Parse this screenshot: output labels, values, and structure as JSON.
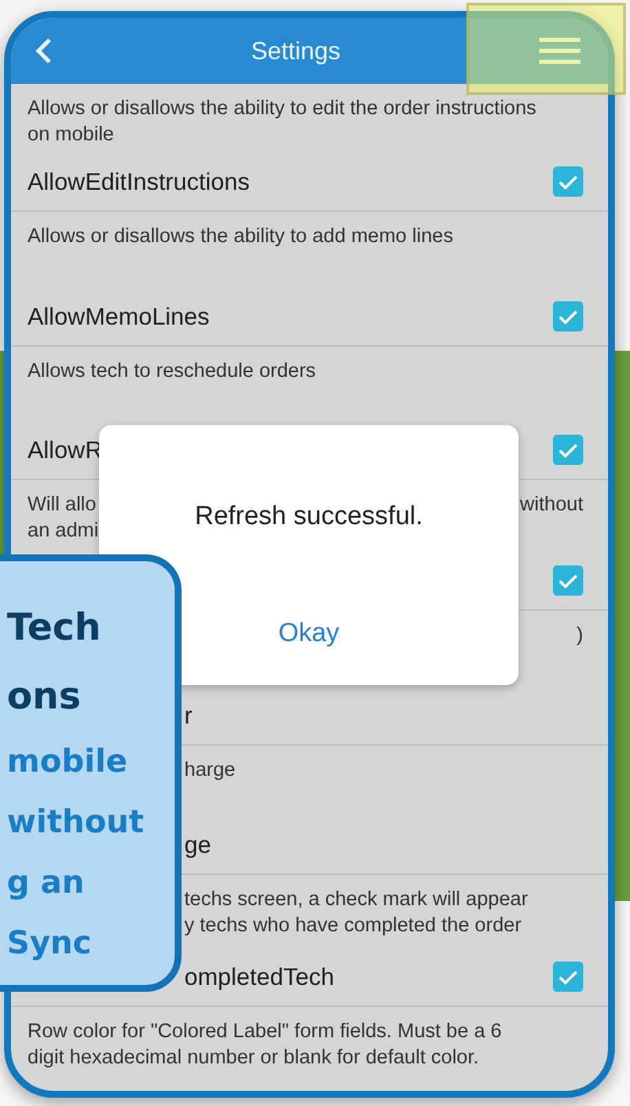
{
  "header": {
    "title": "Settings"
  },
  "rows": [
    {
      "description": [
        {
          "text": "Allows or disallows the ability to edit the order instructions",
          "kind": "start"
        },
        {
          "text": "on mobile",
          "kind": "start"
        }
      ],
      "name": [
        {
          "text": "AllowEditInstructions",
          "kind": "start"
        }
      ],
      "checked": true
    },
    {
      "description": [
        {
          "text": "Allows or disallows the ability to add memo lines",
          "kind": "start"
        }
      ],
      "name": [
        {
          "text": "AllowMemoLines",
          "kind": "start"
        }
      ],
      "checked": true
    },
    {
      "description": [
        {
          "text": "Allows tech to reschedule orders",
          "kind": "start"
        }
      ],
      "name": [
        {
          "text": "AllowR",
          "kind": "start"
        }
      ],
      "checked": true
    },
    {
      "description": [
        {
          "text": "Will allo",
          "kind": "start"
        },
        {
          "text": "without",
          "kind": "end"
        },
        {
          "text": "an admi",
          "kind": "start"
        }
      ],
      "name": [],
      "checked": true
    },
    {
      "description": [
        {
          "text": ")",
          "kind": "end"
        }
      ],
      "name": [
        {
          "text": "r",
          "kind": "middle"
        }
      ]
    },
    {
      "description": [
        {
          "text": "harge",
          "kind": "middle"
        }
      ],
      "name": [
        {
          "text": "ge",
          "kind": "middle"
        }
      ]
    },
    {
      "description": [
        {
          "text": "techs screen, a check mark will appear",
          "kind": "middle"
        },
        {
          "text": "y techs who have completed the order",
          "kind": "middle"
        }
      ],
      "name": [
        {
          "text": "ompletedTech",
          "kind": "middle"
        }
      ],
      "checked": true
    },
    {
      "description": [
        {
          "text": "Row color for \"Colored Label\" form fields.  Must be a 6",
          "kind": "start"
        },
        {
          "text": "digit hexadecimal number or blank for default color.",
          "kind": "start"
        }
      ],
      "name": []
    }
  ],
  "dialog": {
    "message": "Refresh successful.",
    "button": "Okay"
  },
  "callout": {
    "title_lines": [
      "Tech",
      "ons"
    ],
    "body_lines": [
      "mobile",
      "without",
      "g an",
      "Sync"
    ]
  }
}
